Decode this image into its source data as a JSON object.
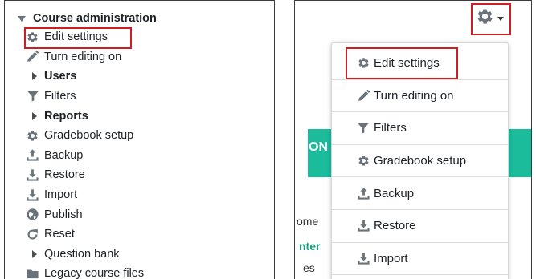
{
  "left": {
    "section_title": "Course administration",
    "items": [
      {
        "label": "Edit settings",
        "icon": "gear-icon",
        "bold": false,
        "expandable": false
      },
      {
        "label": "Turn editing on",
        "icon": "pencil-icon",
        "bold": false,
        "expandable": false
      },
      {
        "label": "Users",
        "icon": "caret-right-icon",
        "bold": true,
        "expandable": true
      },
      {
        "label": "Filters",
        "icon": "filter-icon",
        "bold": false,
        "expandable": false
      },
      {
        "label": "Reports",
        "icon": "caret-right-icon",
        "bold": true,
        "expandable": true
      },
      {
        "label": "Gradebook setup",
        "icon": "gear-icon",
        "bold": false,
        "expandable": false
      },
      {
        "label": "Backup",
        "icon": "upload-icon",
        "bold": false,
        "expandable": false
      },
      {
        "label": "Restore",
        "icon": "download-icon",
        "bold": false,
        "expandable": false
      },
      {
        "label": "Import",
        "icon": "download-icon",
        "bold": false,
        "expandable": false
      },
      {
        "label": "Publish",
        "icon": "globe-icon",
        "bold": false,
        "expandable": false
      },
      {
        "label": "Reset",
        "icon": "refresh-icon",
        "bold": false,
        "expandable": false
      },
      {
        "label": "Question bank",
        "icon": "caret-right-icon",
        "bold": false,
        "expandable": true
      },
      {
        "label": "Legacy course files",
        "icon": "folder-icon",
        "bold": false,
        "expandable": false
      }
    ]
  },
  "right": {
    "background_fragments": {
      "teal_text": "ON",
      "line1": "ome",
      "line2": "nter",
      "line3": "es"
    },
    "menu_items": [
      {
        "label": "Edit settings",
        "icon": "gear-icon"
      },
      {
        "label": "Turn editing on",
        "icon": "pencil-icon"
      },
      {
        "label": "Filters",
        "icon": "filter-icon"
      },
      {
        "label": "Gradebook setup",
        "icon": "gear-icon"
      },
      {
        "label": "Backup",
        "icon": "upload-icon"
      },
      {
        "label": "Restore",
        "icon": "download-icon"
      },
      {
        "label": "Import",
        "icon": "download-icon"
      }
    ]
  },
  "colors": {
    "highlight": "#cc1f24",
    "icon": "#6a737b",
    "teal": "#1abc9c"
  }
}
